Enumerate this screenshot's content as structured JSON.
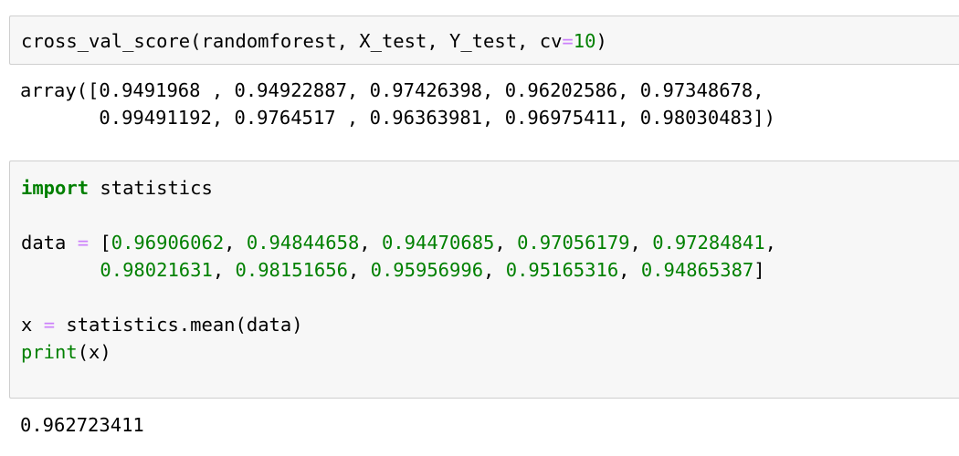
{
  "cells": [
    {
      "input": {
        "line1": {
          "a": "cross_val_score(randomforest, X_test, Y_test, cv",
          "op": "=",
          "num": "10",
          "b": ")"
        }
      },
      "output": {
        "line1": "array([0.9491968 , 0.94922887, 0.97426398, 0.96202586, 0.97348678,",
        "line2": "       0.99491192, 0.9764517 , 0.96363981, 0.96975411, 0.98030483])"
      }
    },
    {
      "input": {
        "line1": {
          "kw": "import",
          "rest": " statistics"
        },
        "line3": {
          "a": "data ",
          "op": "=",
          "b": " [",
          "n1": "0.96906062",
          "s1": ", ",
          "n2": "0.94844658",
          "s2": ", ",
          "n3": "0.94470685",
          "s3": ", ",
          "n4": "0.97056179",
          "s4": ", ",
          "n5": "0.97284841",
          "s5": ","
        },
        "line4": {
          "indent": "       ",
          "n6": "0.98021631",
          "s6": ", ",
          "n7": "0.98151656",
          "s7": ", ",
          "n8": "0.95956996",
          "s8": ", ",
          "n9": "0.95165316",
          "s9": ", ",
          "n10": "0.94865387",
          "end": "]"
        },
        "line6": {
          "a": "x ",
          "op": "=",
          "b": " statistics.mean(data)"
        },
        "line7": {
          "fn": "print",
          "rest": "(x)"
        }
      },
      "output": {
        "line1": "0.962723411"
      }
    }
  ]
}
